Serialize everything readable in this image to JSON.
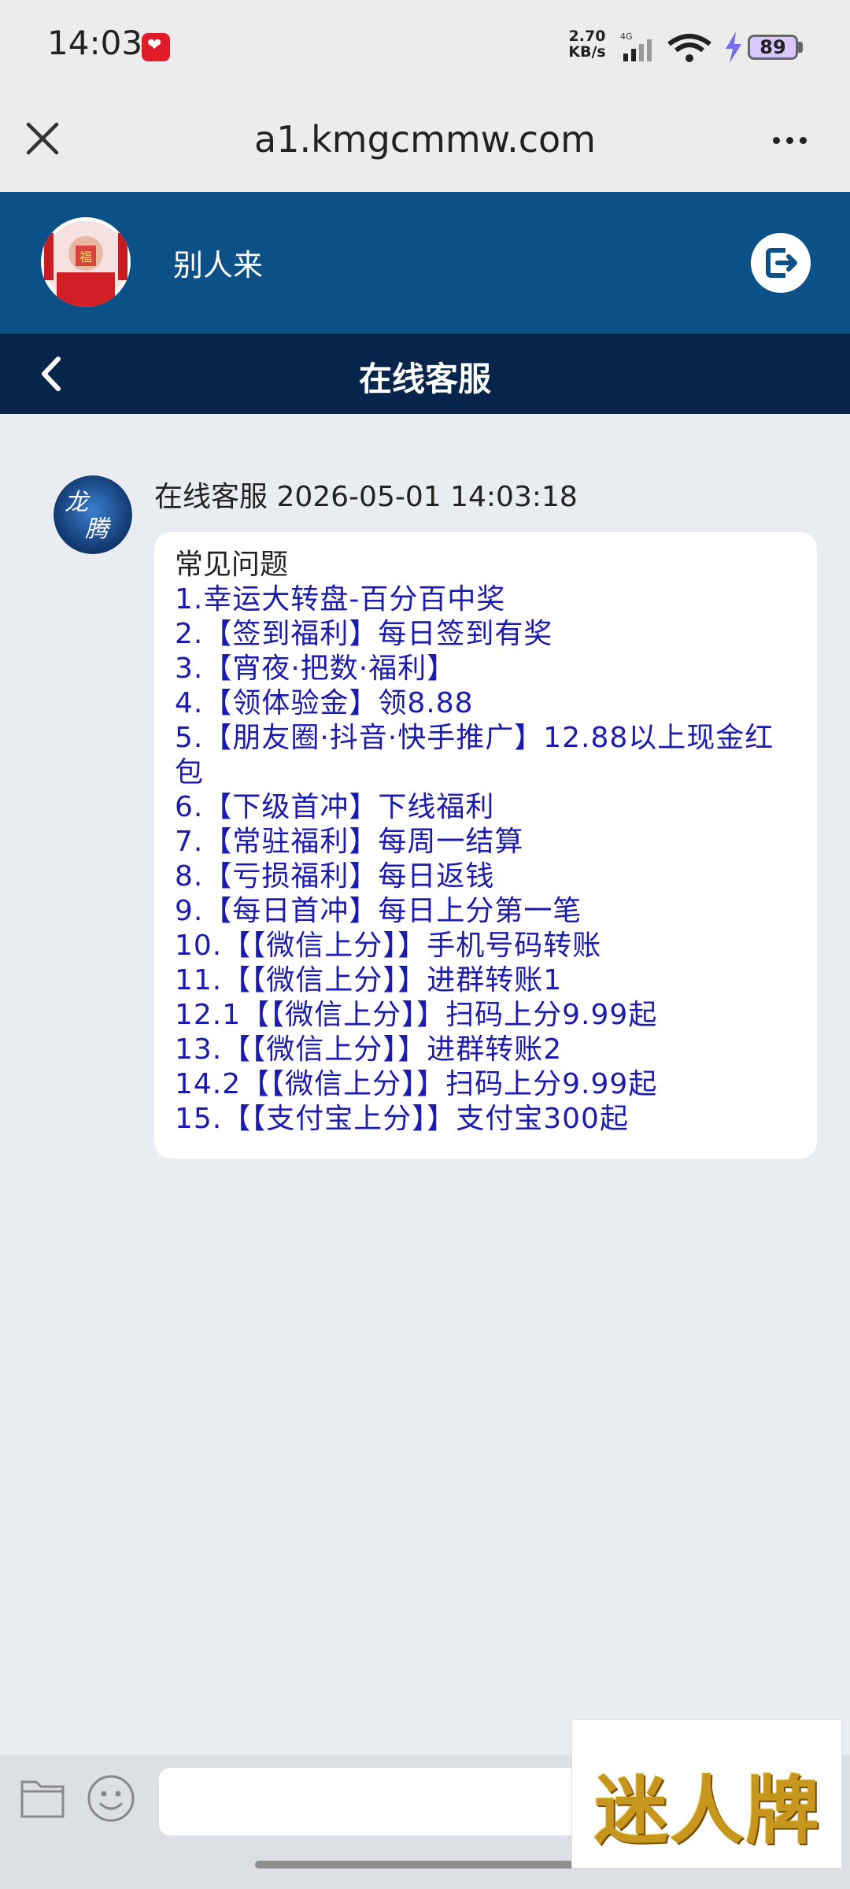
{
  "status_bar": {
    "time": "14:03",
    "net_speed_value": "2.70",
    "net_speed_unit": "KB/s",
    "network_type": "4G",
    "battery": "89",
    "icons": [
      "app-notification-icon",
      "signal-icon",
      "wifi-icon",
      "charging-icon",
      "battery-icon"
    ]
  },
  "browser": {
    "url": "a1.kmgcmmw.com",
    "icons": [
      "close-icon",
      "more-icon"
    ]
  },
  "user": {
    "name": "别人来",
    "icons": [
      "avatar",
      "logout-icon"
    ]
  },
  "title_bar": {
    "title": "在线客服",
    "icons": [
      "back-icon"
    ]
  },
  "message": {
    "meta": "在线客服 2026-05-01 14:03:18",
    "heading": "常见问题",
    "items": [
      "1.幸运大转盘-百分百中奖",
      "2.【签到福利】每日签到有奖",
      "3.【宵夜·把数·福利】",
      "4.【领体验金】领8.88",
      "5.【朋友圈·抖音·快手推广】12.88以上现金红包",
      "6.【下级首冲】下线福利",
      "7.【常驻福利】每周一结算",
      "8.【亏损福利】每日返钱",
      "9.【每日首冲】每日上分第一笔",
      "10.【【微信上分】】手机号码转账",
      "11.【【微信上分】】进群转账1",
      "12.1【【微信上分】】扫码上分9.99起",
      "13.【【微信上分】】进群转账2",
      "14.2【【微信上分】】扫码上分9.99起",
      "15.【【支付宝上分】】支付宝300起"
    ]
  },
  "input_bar": {
    "placeholder": "",
    "icons": [
      "folder-icon",
      "emoji-icon"
    ]
  },
  "watermark": {
    "text": "迷人牌"
  },
  "colors": {
    "user_bar": "#0b5187",
    "title_bar": "#07254a",
    "link_text": "#1b1bb0",
    "background": "#e9edf1"
  }
}
